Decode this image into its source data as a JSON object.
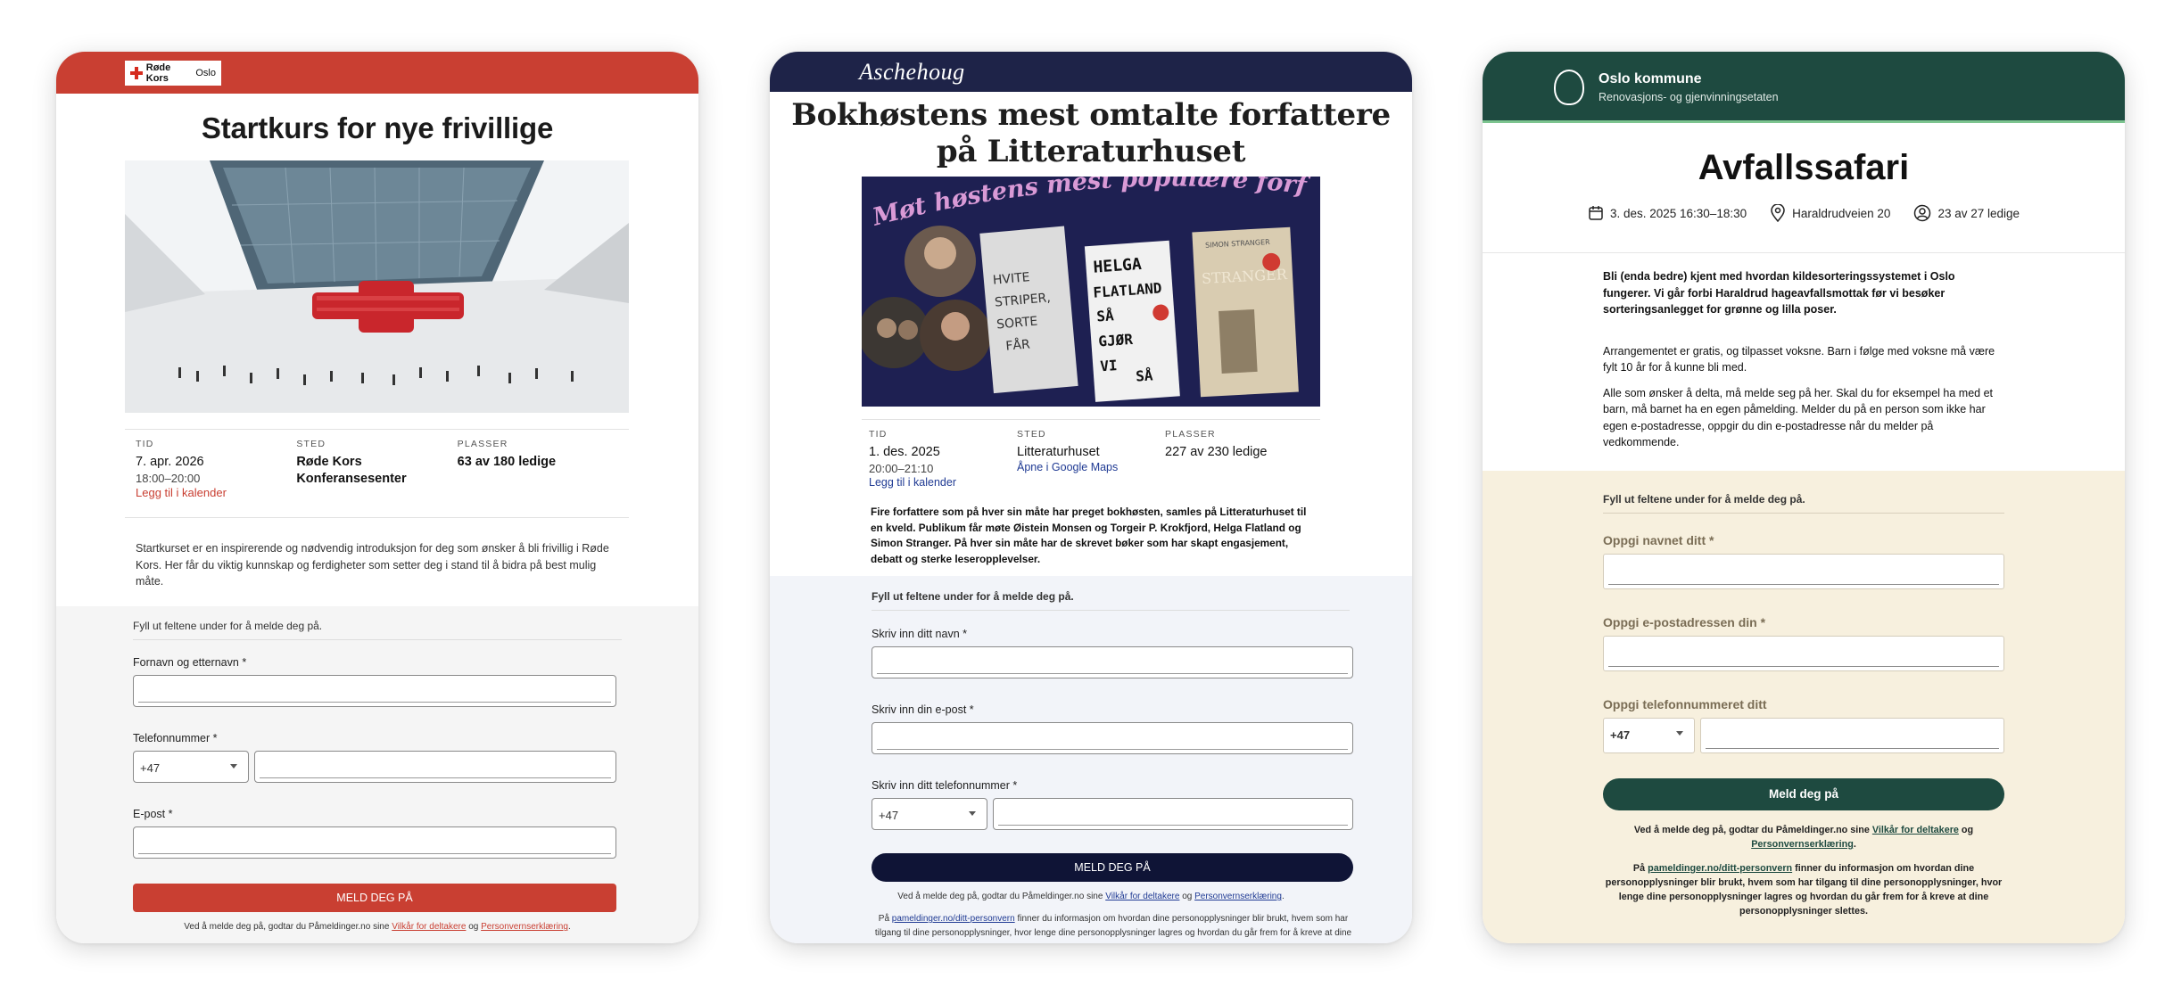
{
  "card1": {
    "brand": {
      "name": "Røde Kors",
      "city": "Oslo"
    },
    "title": "Startkurs for nye frivillige",
    "meta": {
      "time_label": "TID",
      "date": "7. apr. 2026",
      "hours": "18:00–20:00",
      "calendar_link": "Legg til i kalender",
      "place_label": "STED",
      "place": "Røde Kors Konferansesenter",
      "seats_label": "PLASSER",
      "seats": "63 av 180 ledige"
    },
    "description": "Startkurset er en inspirerende og nødvendig introduksjon for deg som ønsker å bli frivillig i Røde Kors. Her får du viktig kunnskap og ferdigheter som setter deg i stand til å bidra på best mulig måte.",
    "form": {
      "hint": "Fyll ut feltene under for å melde deg på.",
      "name_label": "Fornavn og etternavn",
      "phone_label": "Telefonnummer",
      "country_code": "+47",
      "email_label": "E-post",
      "required": "*",
      "submit": "MELD DEG PÅ",
      "terms_prefix": "Ved å melde deg på, godtar du Påmeldinger.no sine",
      "terms_link": "Vilkår for deltakere",
      "terms_and": "og",
      "privacy_link": "Personvernserklæring",
      "terms_end": "."
    },
    "colors": {
      "brand": "#c93f32"
    }
  },
  "card2": {
    "brand": "Aschehoug",
    "title": "Bokhøstens mest omtalte forfattere på Litteraturhuset",
    "banner": {
      "headline": "Møt høstens mest populære forfattere",
      "book1": [
        "HVITE",
        "STRIPER,",
        "SORTE",
        "FÅR"
      ],
      "book2": [
        "HELGA",
        "FLATLAND",
        "SÅ",
        "GJØR",
        "VI",
        "SÅ"
      ],
      "book3_author": "SIMON STRANGER",
      "book3_title": "STRANGER"
    },
    "meta": {
      "time_label": "TID",
      "date": "1. des. 2025",
      "hours": "20:00–21:10",
      "calendar_link": "Legg til i kalender",
      "place_label": "STED",
      "place": "Litteraturhuset",
      "map_link": "Åpne i Google Maps",
      "seats_label": "PLASSER",
      "seats": "227 av 230 ledige"
    },
    "description": "Fire forfattere som på hver sin måte har preget bokhøsten, samles på Litteraturhuset til en kveld. Publikum får møte Øistein Monsen og Torgeir P. Krokfjord, Helga Flatland og Simon Stranger. På hver sin måte har de skrevet bøker som har skapt engasjement, debatt og sterke leseropplevelser.",
    "form": {
      "hint": "Fyll ut feltene under for å melde deg på.",
      "name_label": "Skriv inn ditt navn",
      "email_label": "Skriv inn din e-post",
      "phone_label": "Skriv inn ditt telefonnummer",
      "country_code": "+47",
      "required": "*",
      "submit": "MELD DEG PÅ",
      "terms_prefix": "Ved å melde deg på, godtar du Påmeldinger.no sine",
      "terms_link": "Vilkår for deltakere",
      "terms_and": "og",
      "privacy_link": "Personvernserklæring",
      "terms_end": ".",
      "privacy_prefix": "På",
      "privacy_url": "pameldinger.no/ditt-personvern",
      "privacy_text": "finner du informasjon om hvordan dine personopplysninger blir brukt, hvem som har tilgang til dine personopplysninger, hvor lenge dine personopplysninger lagres og hvordan du går frem for å kreve at dine"
    },
    "colors": {
      "brand": "#1e2348"
    }
  },
  "card3": {
    "brand": {
      "name": "Oslo kommune",
      "sub": "Renovasjons- og gjenvinningsetaten"
    },
    "title": "Avfallssafari",
    "meta": {
      "date": "3. des. 2025 16:30–18:30",
      "place": "Haraldrudveien 20",
      "seats": "23 av 27 ledige"
    },
    "intro": "Bli (enda bedre) kjent med hvordan kildesorteringssystemet i Oslo fungerer. Vi går forbi Haraldrud hageavfallsmottak før vi besøker sorteringsanlegget for grønne og lilla poser.",
    "para1": "Arrangementet er gratis, og tilpasset voksne. Barn i følge med voksne må være fylt 10 år for å kunne bli med.",
    "para2": "Alle som ønsker å delta, må melde seg på her. Skal du for eksempel ha med et barn, må barnet ha en egen påmelding. Melder du på en person som ikke har egen e-postadresse, oppgir du din e-postadresse når du melder på vedkommende.",
    "form": {
      "hint": "Fyll ut feltene under for å melde deg på.",
      "name_label": "Oppgi navnet ditt",
      "email_label": "Oppgi e-postadressen din",
      "phone_label": "Oppgi telefonnummeret ditt",
      "country_code": "+47",
      "required": "*",
      "submit": "Meld deg på",
      "terms_prefix": "Ved å melde deg på, godtar du Påmeldinger.no sine",
      "terms_link": "Vilkår for deltakere",
      "terms_and": "og",
      "privacy_link": "Personvernserklæring",
      "terms_end": ".",
      "privacy_prefix": "På",
      "privacy_url": "pameldinger.no/ditt-personvern",
      "privacy_text": "finner du informasjon om hvordan dine personopplysninger blir brukt, hvem som har tilgang til dine personopplysninger, hvor lenge dine personopplysninger lagres og hvordan du går frem for å kreve at dine personopplysninger slettes."
    },
    "colors": {
      "brand": "#1e4a40",
      "form_bg": "#f7f0de"
    }
  }
}
